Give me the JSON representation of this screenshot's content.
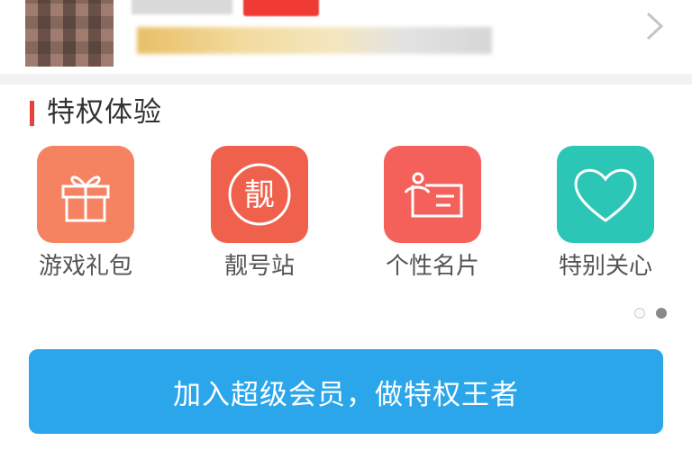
{
  "section": {
    "title": "特权体验"
  },
  "privileges": [
    {
      "label": "游戏礼包",
      "icon": "gift-icon",
      "color": "#f58260"
    },
    {
      "label": "靓号站",
      "icon": "liang-icon",
      "color": "#f0614d"
    },
    {
      "label": "个性名片",
      "icon": "name-card-icon",
      "color": "#f4615a"
    },
    {
      "label": "特别关心",
      "icon": "heart-icon",
      "color": "#2cc6b6"
    }
  ],
  "pager": {
    "count": 2,
    "active": 2
  },
  "join_button": {
    "label": "加入超级会员，做特权王者",
    "color": "#2ba6ea"
  }
}
